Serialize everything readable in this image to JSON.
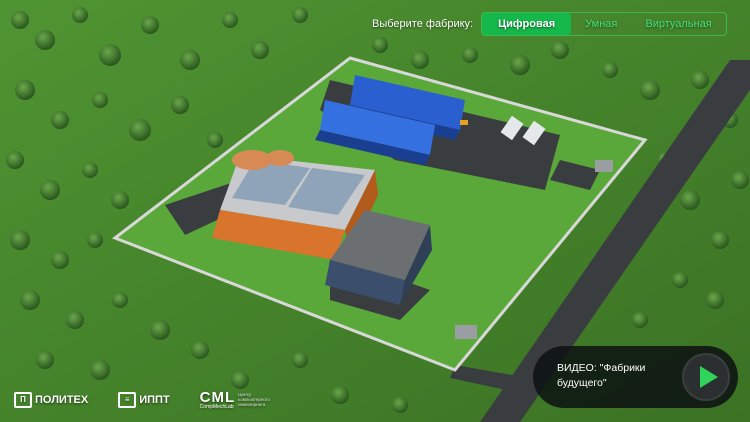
{
  "factory_selector": {
    "label": "Выберите фабрику:",
    "tabs": [
      {
        "label": "Цифровая",
        "active": true
      },
      {
        "label": "Умная",
        "active": false
      },
      {
        "label": "Виртуальная",
        "active": false
      }
    ]
  },
  "video": {
    "label": "ВИДЕО: \"Фабрики будущего\"",
    "play_icon": "play-icon"
  },
  "logos": [
    {
      "name": "ПОЛИТЕХ",
      "mark": "П"
    },
    {
      "name": "ИППТ",
      "mark": "≡"
    },
    {
      "name": "CML",
      "sub": "CompMechLab",
      "side": "Центр компьютерного инжиниринга"
    }
  ],
  "colors": {
    "accent": "#15b84a",
    "grass": "#4f9a33",
    "asphalt": "#3a3d40",
    "roof_blue": "#2a5fd0",
    "roof_orange": "#d9742d"
  }
}
